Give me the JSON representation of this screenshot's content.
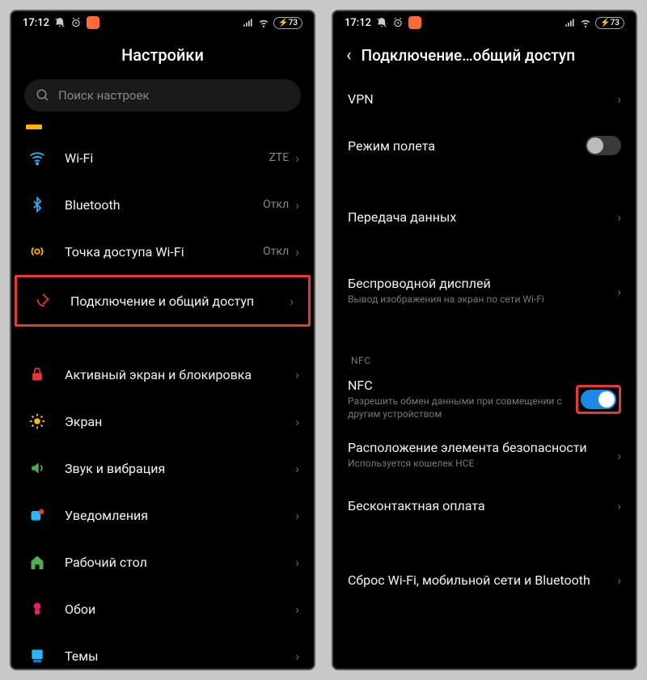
{
  "status": {
    "time": "17:12",
    "battery": "73"
  },
  "left_screen": {
    "title": "Настройки",
    "search_placeholder": "Поиск настроек",
    "rows": {
      "wifi": {
        "label": "Wi-Fi",
        "value": "ZTE"
      },
      "bluetooth": {
        "label": "Bluetooth",
        "value": "Откл"
      },
      "hotspot": {
        "label": "Точка доступа Wi-Fi",
        "value": "Откл"
      },
      "connection": {
        "label": "Подключение и общий доступ"
      },
      "lock": {
        "label": "Активный экран и блокировка"
      },
      "display": {
        "label": "Экран"
      },
      "sound": {
        "label": "Звук и вибрация"
      },
      "notifications": {
        "label": "Уведомления"
      },
      "desktop": {
        "label": "Рабочий стол"
      },
      "wallpaper": {
        "label": "Обои"
      },
      "themes": {
        "label": "Темы"
      }
    }
  },
  "right_screen": {
    "title": "Подключение…общий доступ",
    "rows": {
      "vpn": {
        "label": "VPN"
      },
      "airplane": {
        "label": "Режим полета"
      },
      "data": {
        "label": "Передача данных"
      },
      "wireless_display": {
        "label": "Беспроводной дисплей",
        "sub": "Вывод изображения на экран по сети Wi-Fi"
      },
      "nfc_header": "NFC",
      "nfc": {
        "label": "NFC",
        "sub": "Разрешить обмен данными при совмещении с другим устройством"
      },
      "secure_element": {
        "label": "Расположение элемента безопасности",
        "sub": "Используется кошелек HCE"
      },
      "contactless": {
        "label": "Бесконтактная оплата"
      },
      "reset": {
        "label": "Сброс Wi-Fi, мобильной сети и Bluetooth"
      }
    }
  }
}
